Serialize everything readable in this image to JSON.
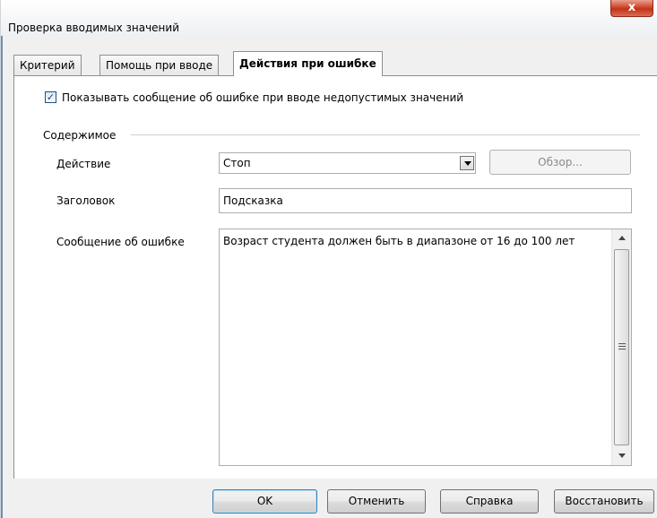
{
  "window": {
    "title": "Проверка вводимых значений",
    "close_label": "x"
  },
  "tabs": [
    {
      "label": "Критерий",
      "active": false
    },
    {
      "label": "Помощь при вводе",
      "active": false
    },
    {
      "label": "Действия при ошибке",
      "active": true
    }
  ],
  "options": {
    "show_error_checkbox": {
      "checked": true,
      "label": "Показывать сообщение об ошибке при вводе недопустимых значений"
    }
  },
  "contents_group": {
    "title": "Содержимое",
    "action": {
      "label": "Действие",
      "value": "Стоп"
    },
    "browse_button": "Обзор...",
    "heading": {
      "label": "Заголовок",
      "value": "Подсказка"
    },
    "error_message": {
      "label": "Сообщение об ошибке",
      "value": "Возраст студента должен быть в диапазоне от 16 до 100 лет"
    }
  },
  "buttons": {
    "ok": "OK",
    "cancel": "Отменить",
    "help": "Справка",
    "reset": "Восстановить"
  },
  "colors": {
    "close_button": "#c2331a",
    "checkbox_mark": "#1e3a6e",
    "default_button_border": "#3c7fb1"
  }
}
